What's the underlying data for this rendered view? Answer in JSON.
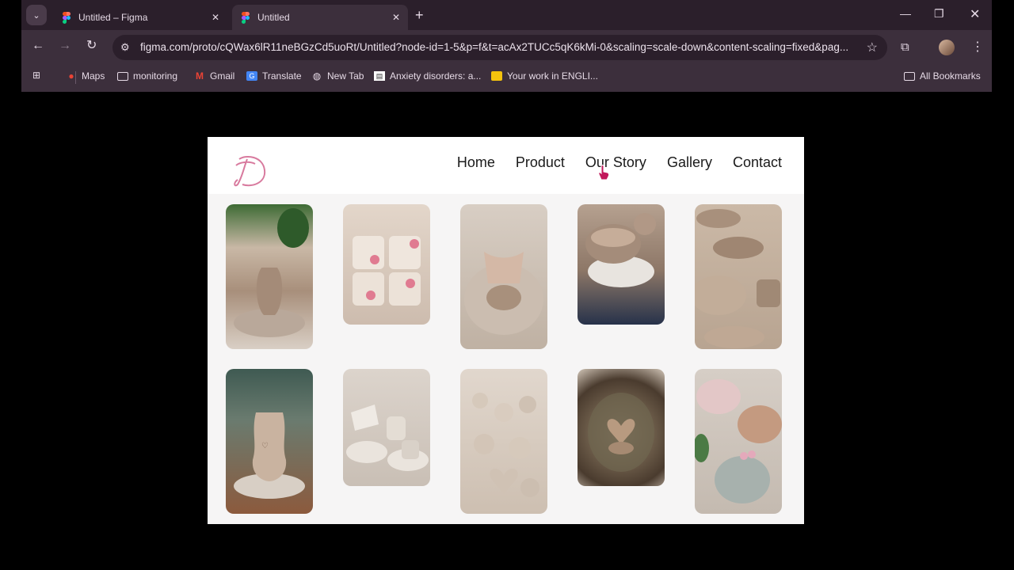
{
  "browser": {
    "tabs": [
      {
        "title": "Untitled – Figma",
        "active": false
      },
      {
        "title": "Untitled",
        "active": true
      }
    ],
    "url": "figma.com/proto/cQWax6lR11neBGzCd5uoRt/Untitled?node-id=1-5&p=f&t=acAx2TUCc5qK6kMi-0&scaling=scale-down&content-scaling=fixed&pag...",
    "bookmarks": [
      {
        "label": "Maps",
        "icon": "maps-icon"
      },
      {
        "label": "monitoring",
        "icon": "folder-icon"
      },
      {
        "label": "Gmail",
        "icon": "gmail-icon"
      },
      {
        "label": "Translate",
        "icon": "translate-icon"
      },
      {
        "label": "New Tab",
        "icon": "globe-icon"
      },
      {
        "label": "Anxiety disorders: a...",
        "icon": "article-icon"
      },
      {
        "label": "Your work in ENGLI...",
        "icon": "classroom-icon"
      }
    ],
    "all_bookmarks": "All Bookmarks"
  },
  "site": {
    "nav": [
      "Home",
      "Product",
      "Our Story",
      "Gallery",
      "Contact"
    ],
    "logo_icon": "d-monogram-logo",
    "accent_color": "#d87a9e",
    "gallery": [
      {
        "desc": "throwing a vase on the wheel",
        "icon": "pottery-photo"
      },
      {
        "desc": "mugs with pink flowers",
        "icon": "pottery-photo"
      },
      {
        "desc": "hands centering clay",
        "icon": "pottery-photo"
      },
      {
        "desc": "bowl on wheel",
        "icon": "pottery-photo"
      },
      {
        "desc": "stacked plates and bowls",
        "icon": "pottery-photo"
      },
      {
        "desc": "heart-marked vase on wheel",
        "icon": "pottery-photo"
      },
      {
        "desc": "tea set with saucers",
        "icon": "pottery-photo"
      },
      {
        "desc": "assorted bisque pieces",
        "icon": "pottery-photo"
      },
      {
        "desc": "heart-shaped vessel in splash pan",
        "icon": "pottery-photo"
      },
      {
        "desc": "pink flower bowls",
        "icon": "pottery-photo"
      }
    ]
  }
}
